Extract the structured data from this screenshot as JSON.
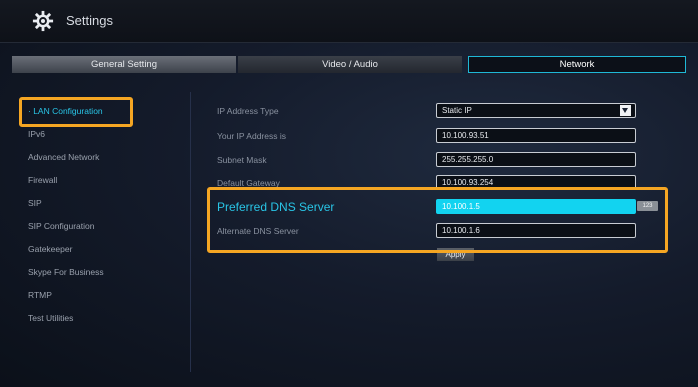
{
  "window": {
    "title": "Settings"
  },
  "tabs": [
    "General Setting",
    "Video / Audio",
    "Network"
  ],
  "sidebar": {
    "items": [
      {
        "label": "· LAN Configuration",
        "active": true
      },
      {
        "label": "IPv6"
      },
      {
        "label": "Advanced Network"
      },
      {
        "label": "Firewall"
      },
      {
        "label": "SIP"
      },
      {
        "label": "SIP Configuration"
      },
      {
        "label": "Gatekeeper"
      },
      {
        "label": "Skype For Business"
      },
      {
        "label": "RTMP"
      },
      {
        "label": "Test Utilities"
      }
    ]
  },
  "form": {
    "rows": [
      {
        "label": "IP Address Type",
        "value": "Static IP"
      },
      {
        "label": "Your IP Address is",
        "value": "10.100.93.51"
      },
      {
        "label": "Subnet Mask",
        "value": "255.255.255.0"
      },
      {
        "label": "Default Gateway",
        "value": "10.100.93.254"
      },
      {
        "label": "Preferred DNS Server",
        "value": "10.100.1.5"
      },
      {
        "label": "Alternate DNS Server",
        "value": "10.100.1.6"
      }
    ],
    "input_mode_badge": "123",
    "apply_label": "Apply"
  },
  "colors": {
    "accent": "#29c5e6",
    "highlight_box": "#f5a623",
    "selected_field": "#12d3f0"
  },
  "icons": {
    "settings": "gear-icon",
    "dropdown": "chevron-down-icon"
  }
}
